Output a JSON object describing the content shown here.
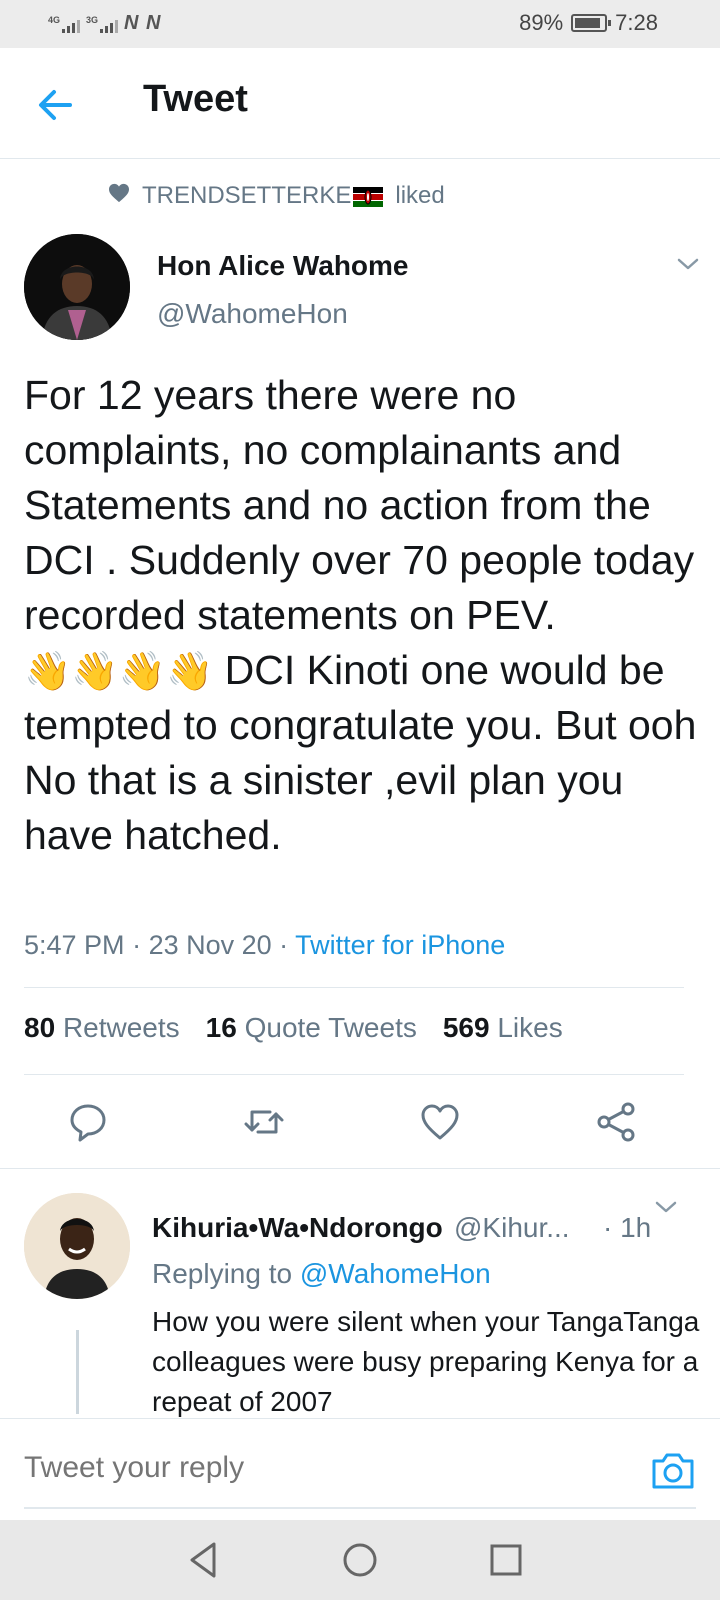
{
  "status_bar": {
    "signal1": "4G",
    "signal2": "3G",
    "carrier_icons": "N N",
    "battery_percent": "89%",
    "battery_level": 0.89,
    "time": "7:28"
  },
  "header": {
    "title": "Tweet",
    "back_icon": "arrow-left-icon"
  },
  "social_context": {
    "icon": "heart-icon",
    "user": "TRENDSETTERKE",
    "flag": "kenya-flag-emoji",
    "action": "liked"
  },
  "tweet": {
    "author_name": "Hon Alice Wahome",
    "author_handle": "@WahomeHon",
    "text_part1": "For 12 years there were no complaints, no complainants and Statements and no action from the DCI . Suddenly over 70 people today recorded statements on PEV. ",
    "emojis": "👋👋👋👋",
    "text_part2": " DCI Kinoti one would be tempted to congratulate you. But ooh No that is a sinister ,evil plan you have hatched.",
    "time": "5:47 PM",
    "date": "23 Nov 20",
    "source": "Twitter for iPhone",
    "retweets_count": "80",
    "retweets_label": "Retweets",
    "quotes_count": "16",
    "quotes_label": "Quote Tweets",
    "likes_count": "569",
    "likes_label": "Likes"
  },
  "actions": [
    "reply-icon",
    "retweet-icon",
    "like-icon",
    "share-icon"
  ],
  "reply": {
    "author_name": "Kihuria•Wa•Ndorongo",
    "author_handle": "@Kihur...",
    "time": "· 1h",
    "replying_prefix": "Replying to",
    "replying_to": "@WahomeHon",
    "text": "How you were silent when your TangaTanga colleagues were busy preparing Kenya for a repeat of 2007"
  },
  "reply_box": {
    "placeholder": "Tweet your reply",
    "icon": "camera-icon"
  },
  "colors": {
    "accent": "#1da1f2",
    "link": "#1b95e0",
    "secondary_text": "#657786",
    "primary_text": "#14171a"
  }
}
